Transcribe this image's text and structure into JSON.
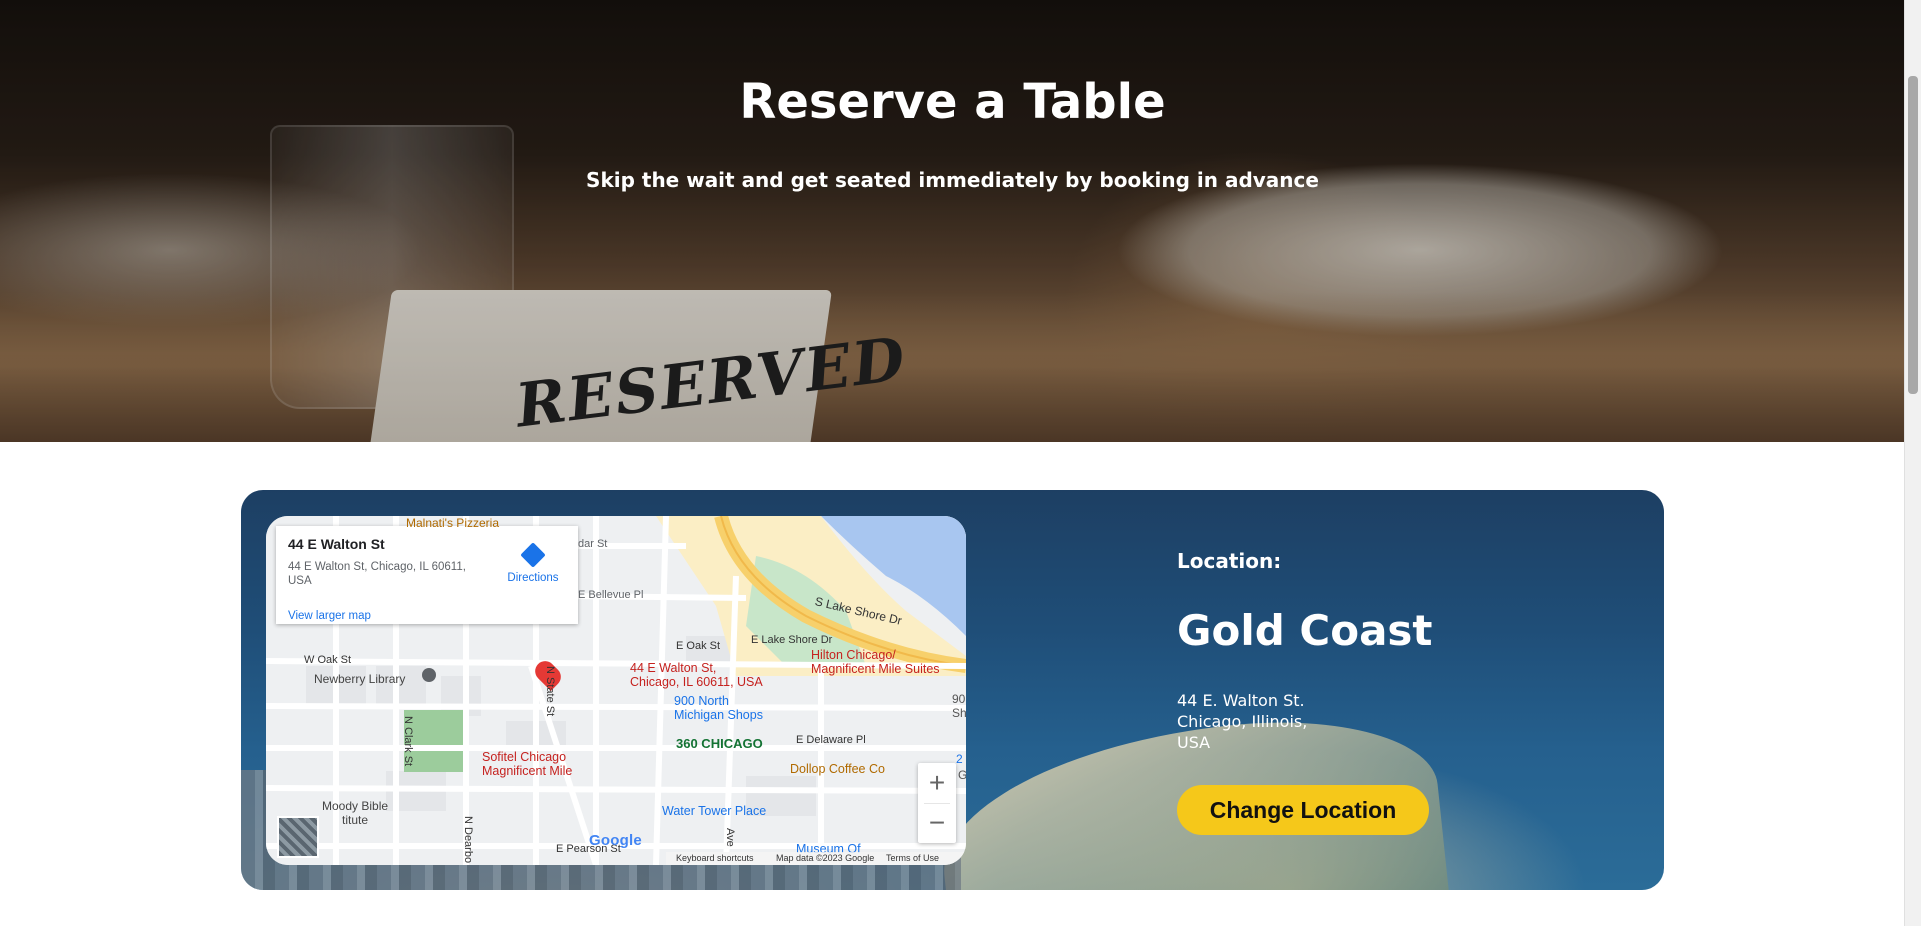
{
  "hero": {
    "title": "Reserve a Table",
    "subtitle": "Skip the wait and get seated immediately by booking in advance",
    "card_text": "RESERVED"
  },
  "map": {
    "info": {
      "title": "44 E Walton St",
      "address": "44 E Walton St, Chicago, IL 60611, USA",
      "directions_label": "Directions",
      "larger_map_label": "View larger map"
    },
    "labels": {
      "malnatis": "Malnati's Pizzeria",
      "cedar": "dar St",
      "bellevue": "E Bellevue Pl",
      "lake_shore_dr_diag": "S Lake Shore Dr",
      "e_oak": "E Oak St",
      "e_lake_shore": "E Lake Shore Dr",
      "w_oak": "W Oak St",
      "newberry": "Newberry Library",
      "pin_address": "44 E Walton St,\nChicago, IL 60611, USA",
      "hilton": "Hilton Chicago/\nMagnificent Mile Suites",
      "nine_hundred": "900 North\nMichigan Shops",
      "n_state": "N State St",
      "n_clark": "N Clark St",
      "three_sixty": "360 CHICAGO",
      "delaware": "E Delaware Pl",
      "sofitel": "Sofitel Chicago\nMagnificent Mile",
      "dollop": "Dollop Coffee Co",
      "water_tower": "Water Tower Place",
      "moody": "Moody Bible\n      titute",
      "n_dearborn": "N Dearbo",
      "pearson": "E Pearson St",
      "ave": "Ave",
      "museum": "Museum Of",
      "edge_90": "90\nSh",
      "edge_g": "G",
      "edge_2": "2"
    },
    "zoom_in": "+",
    "zoom_out": "−",
    "google_logo": "Google",
    "footer": {
      "shortcuts": "Keyboard shortcuts",
      "data": "Map data ©2023 Google",
      "terms": "Terms of Use"
    },
    "colors": {
      "water": "#a8c6f0",
      "park": "#c8e6c9",
      "road": "#ffffff",
      "highway": "#f7d06b",
      "pin": "#e53935",
      "link": "#1a73e8"
    }
  },
  "location": {
    "label": "Location:",
    "name": "Gold Coast",
    "address_line1": "44 E. Walton St.",
    "address_line2": "Chicago, Illinois,",
    "address_line3": "USA",
    "change_button": "Change Location",
    "button_color": "#f5c81a"
  }
}
